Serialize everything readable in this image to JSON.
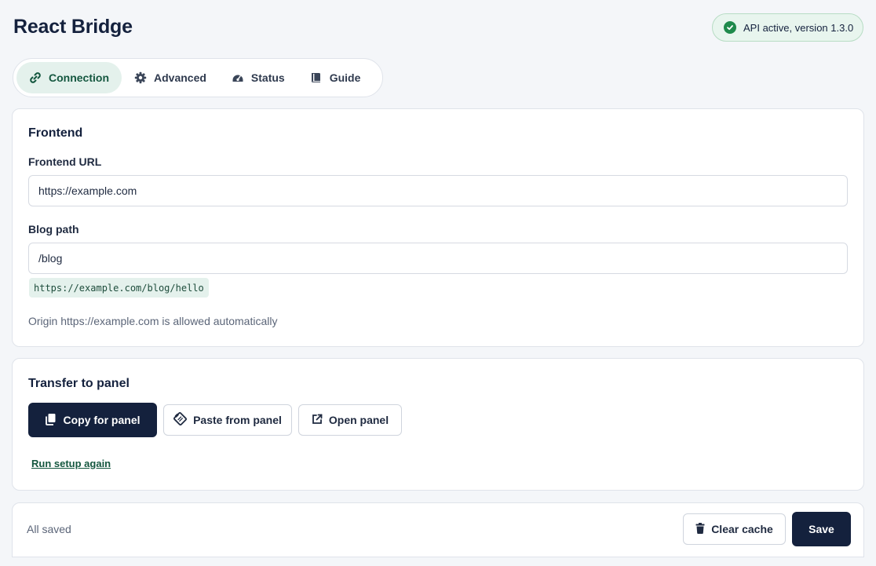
{
  "app": {
    "title": "React Bridge"
  },
  "api_status": {
    "text": "API active, version 1.3.0",
    "color": "#1f8a4c"
  },
  "tabs": [
    {
      "label": "Connection",
      "icon": "link-icon",
      "active": true
    },
    {
      "label": "Advanced",
      "icon": "gear-icon",
      "active": false
    },
    {
      "label": "Status",
      "icon": "gauge-icon",
      "active": false
    },
    {
      "label": "Guide",
      "icon": "book-icon",
      "active": false
    }
  ],
  "frontend_card": {
    "title": "Frontend",
    "url_label": "Frontend URL",
    "url_value": "https://example.com",
    "blog_label": "Blog path",
    "blog_value": "/blog",
    "preview": "https://example.com/blog/hello",
    "hint": "Origin https://example.com is allowed automatically"
  },
  "transfer_card": {
    "title": "Transfer to panel",
    "copy_label": "Copy for panel",
    "paste_label": "Paste from panel",
    "open_label": "Open panel",
    "setup_link": "Run setup again"
  },
  "footer": {
    "status": "All saved",
    "clear_label": "Clear cache",
    "save_label": "Save"
  },
  "colors": {
    "primary": "#14213d",
    "accent": "#14573f",
    "accent_bg": "#e4f1ec"
  }
}
